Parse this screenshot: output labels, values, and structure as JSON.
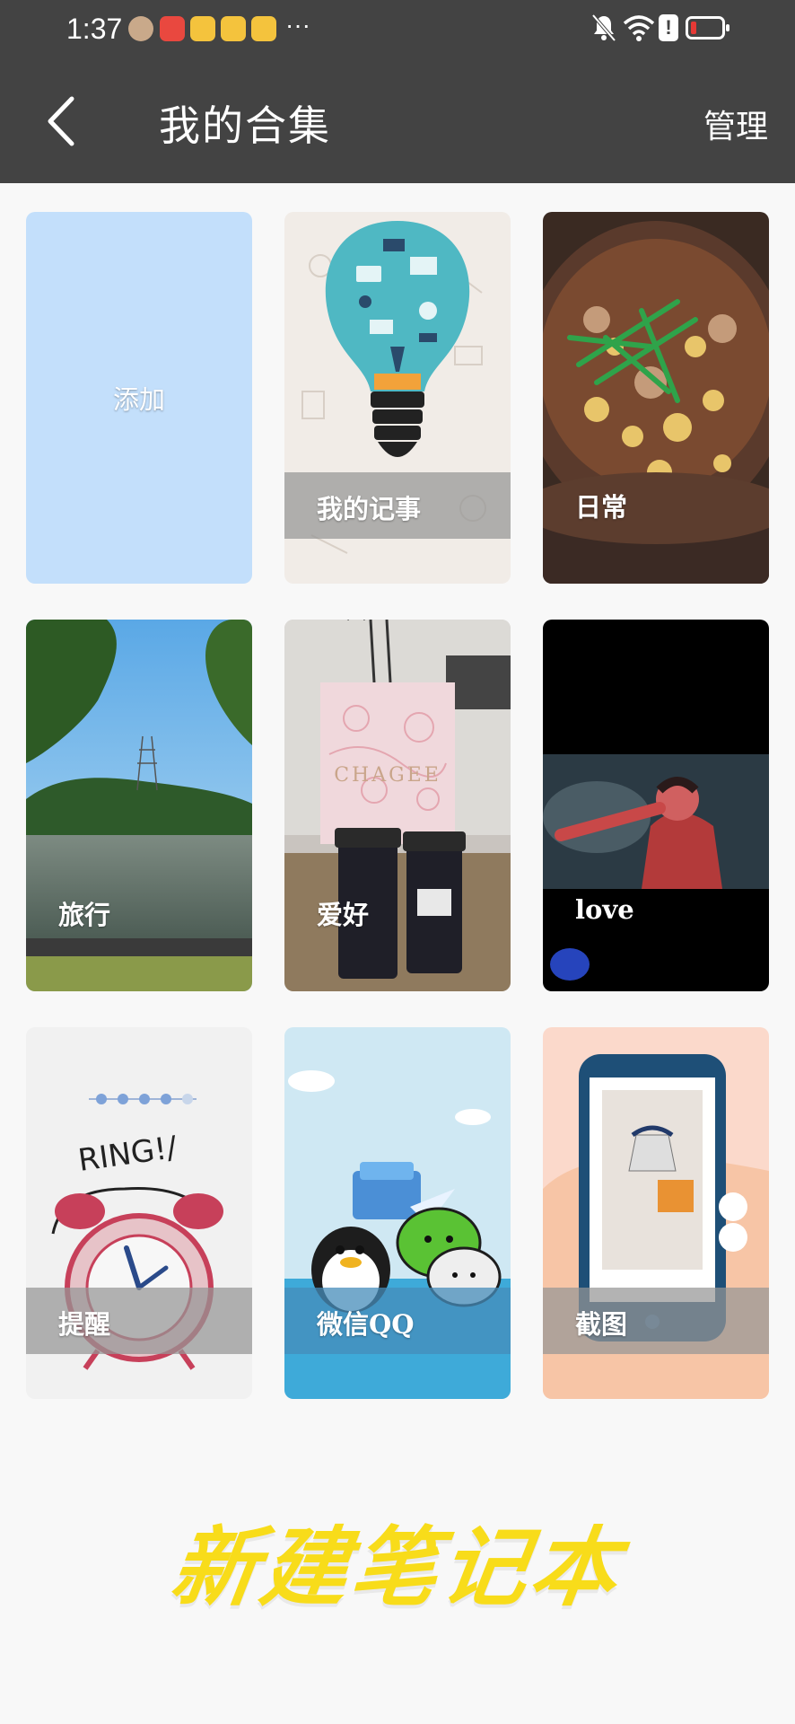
{
  "status_bar": {
    "time": "1:37",
    "more": "···"
  },
  "header": {
    "title": "我的合集",
    "manage_label": "管理"
  },
  "collections": [
    {
      "label": "添加",
      "type": "add"
    },
    {
      "label": "我的记事"
    },
    {
      "label": "日常"
    },
    {
      "label": "旅行"
    },
    {
      "label": "爱好"
    },
    {
      "label": "love"
    },
    {
      "label": "提醒"
    },
    {
      "label": "微信QQ"
    },
    {
      "label": "截图"
    }
  ],
  "cover_text": {
    "chagee": "CHAGEE",
    "ring": "RING!/"
  },
  "new_note_label": "新建笔记本",
  "colors": {
    "header_bg": "#434343",
    "add_card_bg": "#c3dffb",
    "new_note": "#f8dc1a"
  }
}
